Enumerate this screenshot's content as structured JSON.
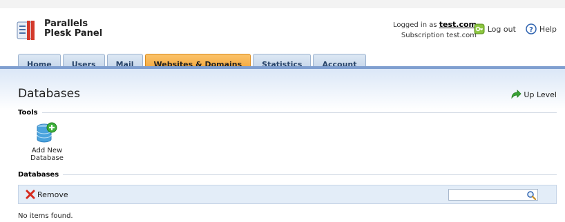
{
  "brand": {
    "line1": "Parallels",
    "line2": "Plesk Panel"
  },
  "login": {
    "logged_in_as": "Logged in as",
    "username": "test.com",
    "subscription_label": "Subscription",
    "subscription": "test.com"
  },
  "toplinks": {
    "logout": "Log out",
    "help": "Help"
  },
  "tabs": [
    {
      "label": "Home"
    },
    {
      "label": "Users"
    },
    {
      "label": "Mail"
    },
    {
      "label": "Websites & Domains",
      "active": true
    },
    {
      "label": "Statistics"
    },
    {
      "label": "Account"
    }
  ],
  "page": {
    "title": "Databases",
    "up_level": "Up Level"
  },
  "tools": {
    "heading": "Tools",
    "add_new_database": "Add New Database"
  },
  "databases": {
    "heading": "Databases",
    "remove_label": "Remove",
    "search_placeholder": "",
    "empty_message": "No items found."
  },
  "icons": {
    "logo": "plesk-logo-icon",
    "logout": "logout-key-icon",
    "help": "help-question-icon",
    "up_level": "up-arrow-icon",
    "add_database": "database-add-icon",
    "remove": "red-x-icon",
    "search": "magnifier-icon"
  },
  "colors": {
    "active_tab": "#f29d2a",
    "tab": "#c9d9ec",
    "bar": "#7f9fd0"
  }
}
